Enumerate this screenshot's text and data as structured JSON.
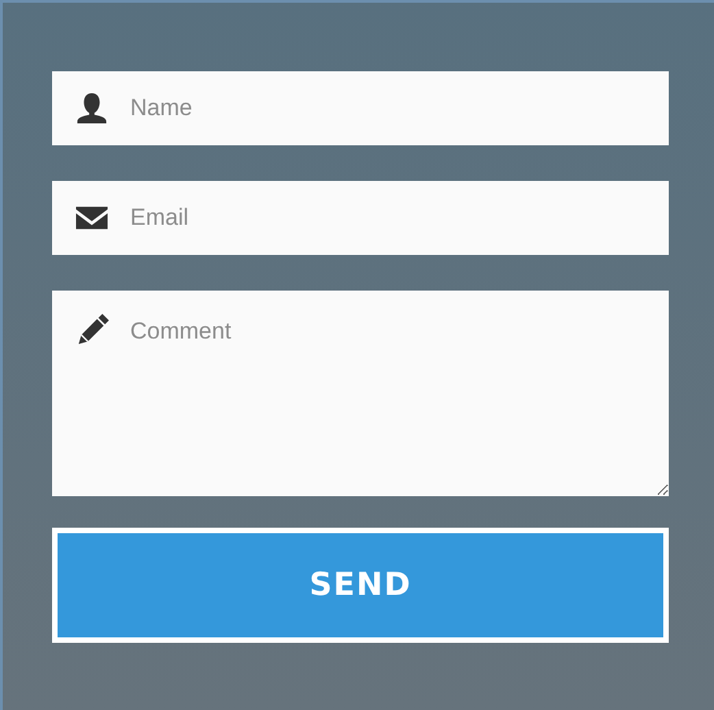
{
  "fields": [
    {
      "kind": "text",
      "placeholder": "Name"
    },
    {
      "kind": "email",
      "placeholder": "Email"
    },
    {
      "kind": "textarea",
      "placeholder": "Comment"
    }
  ],
  "button": {
    "label": "SEND"
  }
}
